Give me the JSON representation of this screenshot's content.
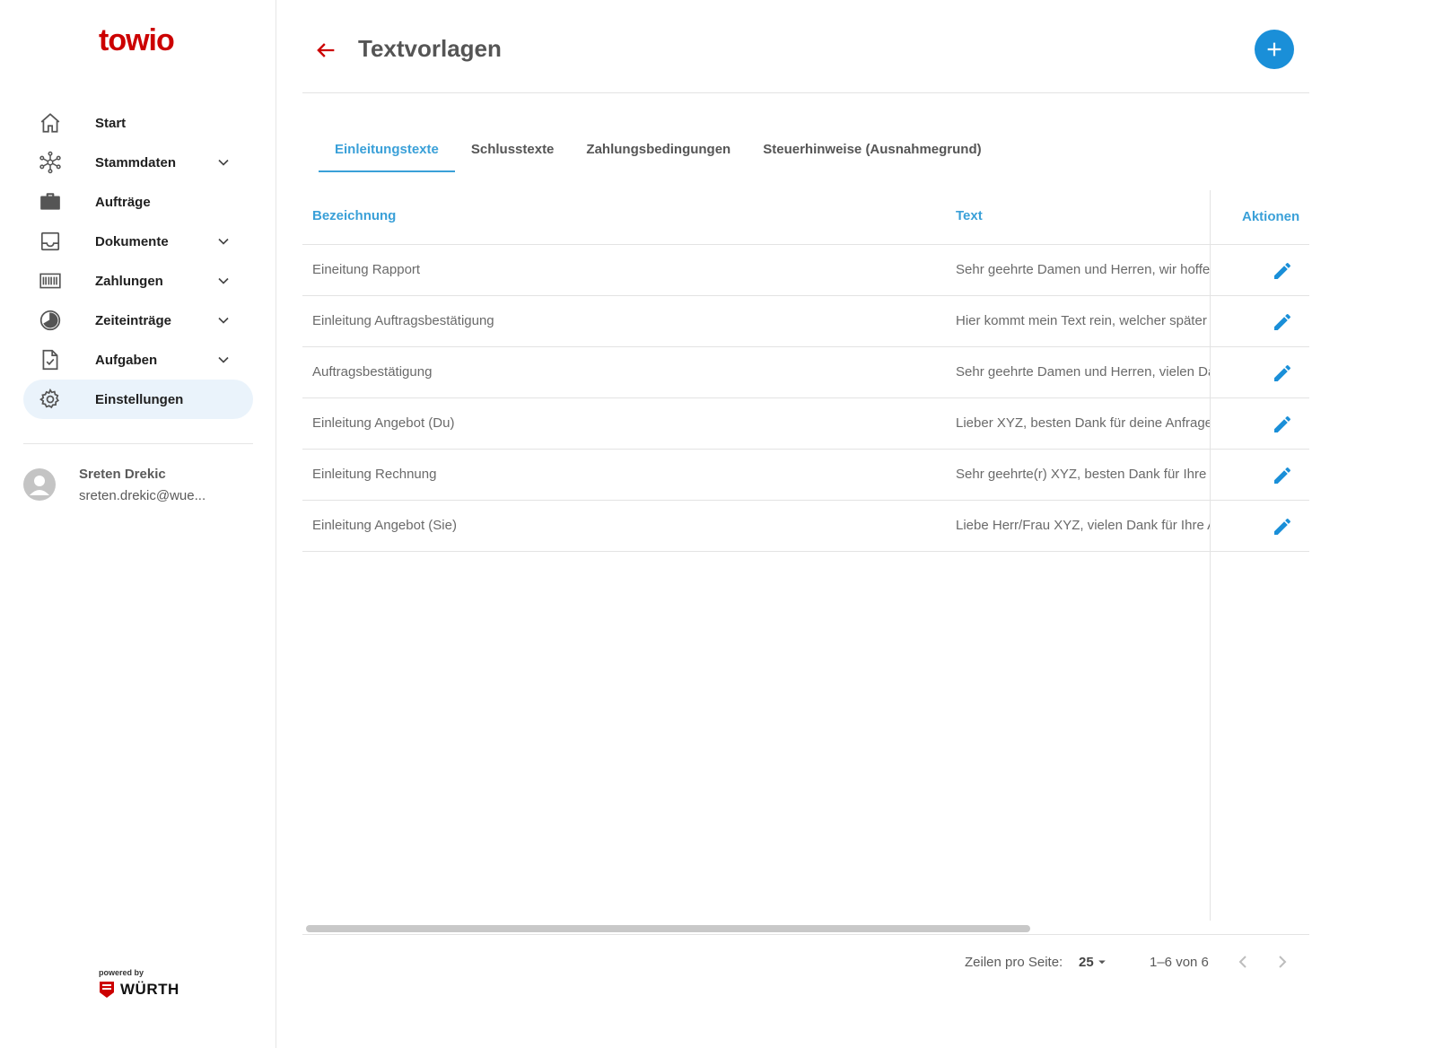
{
  "brand": {
    "logo_text": "towio",
    "logo_color": "#cc0000",
    "accent": "#1a8fd8"
  },
  "sidebar": {
    "items": [
      {
        "label": "Start",
        "icon": "home-icon",
        "expandable": false
      },
      {
        "label": "Stammdaten",
        "icon": "network-icon",
        "expandable": true
      },
      {
        "label": "Aufträge",
        "icon": "briefcase-icon",
        "expandable": false
      },
      {
        "label": "Dokumente",
        "icon": "inbox-icon",
        "expandable": true
      },
      {
        "label": "Zahlungen",
        "icon": "barcode-icon",
        "expandable": true
      },
      {
        "label": "Zeiteinträge",
        "icon": "clock-icon",
        "expandable": true
      },
      {
        "label": "Aufgaben",
        "icon": "task-document-icon",
        "expandable": true
      },
      {
        "label": "Einstellungen",
        "icon": "gear-icon",
        "expandable": false,
        "active": true
      }
    ],
    "user": {
      "name": "Sreten Drekic",
      "email": "sreten.drekic@wue..."
    },
    "footer": {
      "powered_by": "powered by",
      "partner": "WÜRTH"
    }
  },
  "header": {
    "title": "Textvorlagen"
  },
  "tabs": [
    {
      "label": "Einleitungstexte",
      "active": true
    },
    {
      "label": "Schlusstexte"
    },
    {
      "label": "Zahlungsbedingungen"
    },
    {
      "label": "Steuerhinweise (Ausnahmegrund)"
    }
  ],
  "table": {
    "columns": {
      "name": "Bezeichnung",
      "text": "Text",
      "actions": "Aktionen"
    },
    "rows": [
      {
        "name": "Eineitung Rapport",
        "text": "Sehr geehrte Damen und Herren, wir hoffen"
      },
      {
        "name": "Einleitung Auftragsbestätigung",
        "text": "Hier kommt mein Text rein, welcher später"
      },
      {
        "name": "Auftragsbestätigung",
        "text": "Sehr geehrte Damen und Herren, vielen Dank"
      },
      {
        "name": "Einleitung Angebot (Du)",
        "text": "Lieber XYZ, besten Dank für deine Anfrage"
      },
      {
        "name": "Einleitung Rechnung",
        "text": "Sehr geehrte(r) XYZ, besten Dank für Ihre"
      },
      {
        "name": "Einleitung Angebot (Sie)",
        "text": "Liebe Herr/Frau XYZ, vielen Dank für Ihre A"
      }
    ]
  },
  "pagination": {
    "rows_per_page_label": "Zeilen pro Seite:",
    "rows_per_page": "25",
    "range": "1–6 von 6"
  }
}
